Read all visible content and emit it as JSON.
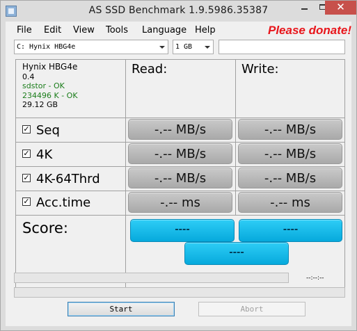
{
  "window": {
    "title": "AS SSD Benchmark 1.9.5986.35387",
    "close_glyph": "✕"
  },
  "menu": {
    "items": [
      "File",
      "Edit",
      "View",
      "Tools",
      "Language",
      "Help"
    ],
    "donate": "Please donate!"
  },
  "selectors": {
    "drive": "C: Hynix HBG4e",
    "size": "1 GB",
    "extra": ""
  },
  "drive_info": {
    "name": "Hynix HBG4e",
    "firmware": "0.4",
    "driver": "sdstor - OK",
    "alignment": "234496 K - OK",
    "capacity": "29.12 GB"
  },
  "columns": {
    "read": "Read:",
    "write": "Write:"
  },
  "tests": [
    {
      "label": "Seq",
      "checked": true,
      "read": "-.-- MB/s",
      "write": "-.-- MB/s"
    },
    {
      "label": "4K",
      "checked": true,
      "read": "-.-- MB/s",
      "write": "-.-- MB/s"
    },
    {
      "label": "4K-64Thrd",
      "checked": true,
      "read": "-.-- MB/s",
      "write": "-.-- MB/s"
    },
    {
      "label": "Acc.time",
      "checked": true,
      "read": "-.-- ms",
      "write": "-.-- ms"
    }
  ],
  "score": {
    "label": "Score:",
    "read": "----",
    "write": "----",
    "total": "----"
  },
  "status": {
    "timer": "--:--:--",
    "progress": 0
  },
  "buttons": {
    "start": "Start",
    "abort": "Abort"
  },
  "colors": {
    "donate": "#e8161c",
    "ok_text": "#1b7d1b",
    "score_button": "#06a9dc",
    "result_button": "#b5b5b5"
  }
}
